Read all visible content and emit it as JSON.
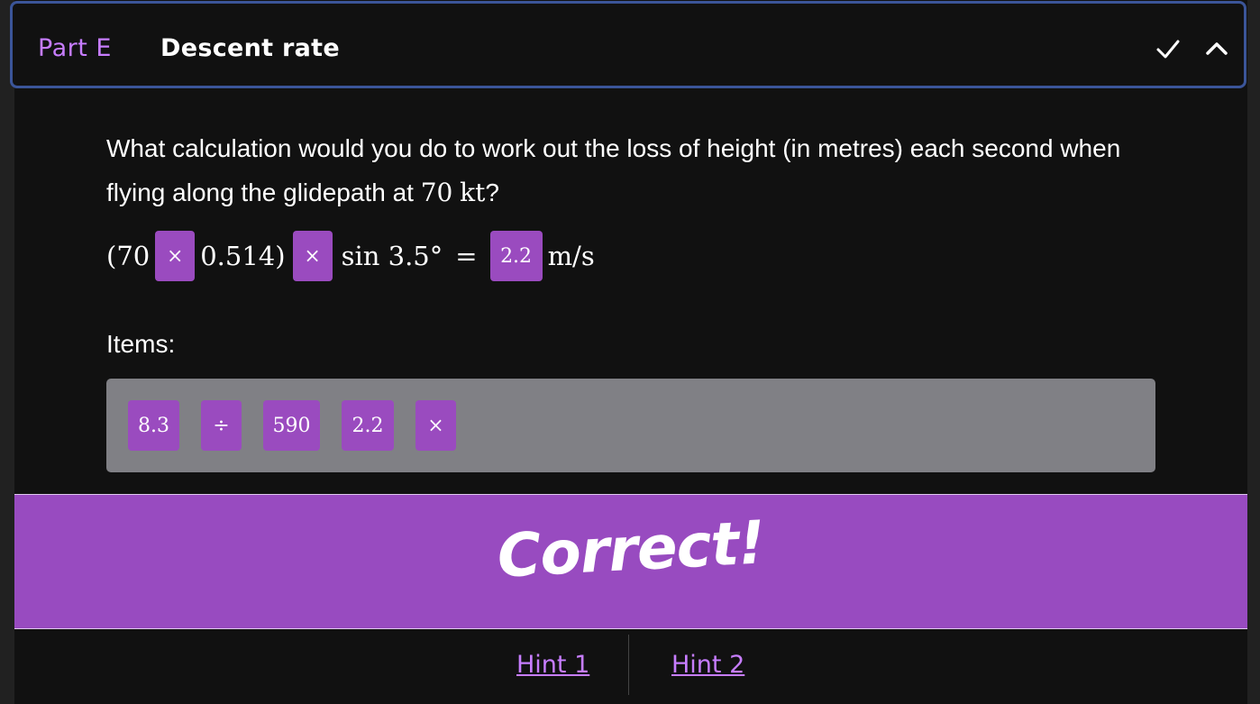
{
  "part": {
    "label": "Part E",
    "title": "Descent rate"
  },
  "header_icons": [
    "check-icon",
    "chevron-up-icon"
  ],
  "question": {
    "text": "What calculation would you do to work out the loss of height (in metres) each second when flying along the glidepath at",
    "speed_value": "70",
    "speed_unit": "kt",
    "end": "?"
  },
  "equation": {
    "open": "(70",
    "slot1": "×",
    "mid1": "0.514)",
    "slot2": "×",
    "mid2": "sin 3.5°",
    "equals": "=",
    "slot3": "2.2",
    "unit": "m/s"
  },
  "items_label": "Items:",
  "items": [
    "8.3",
    "÷",
    "590",
    "2.2",
    "×"
  ],
  "result": "Correct!",
  "hints": [
    "Hint 1",
    "Hint 2"
  ],
  "colors": {
    "accent": "#9a4bbf",
    "banner": "#984bc0",
    "link": "#c77dff",
    "border": "#3b5599"
  }
}
